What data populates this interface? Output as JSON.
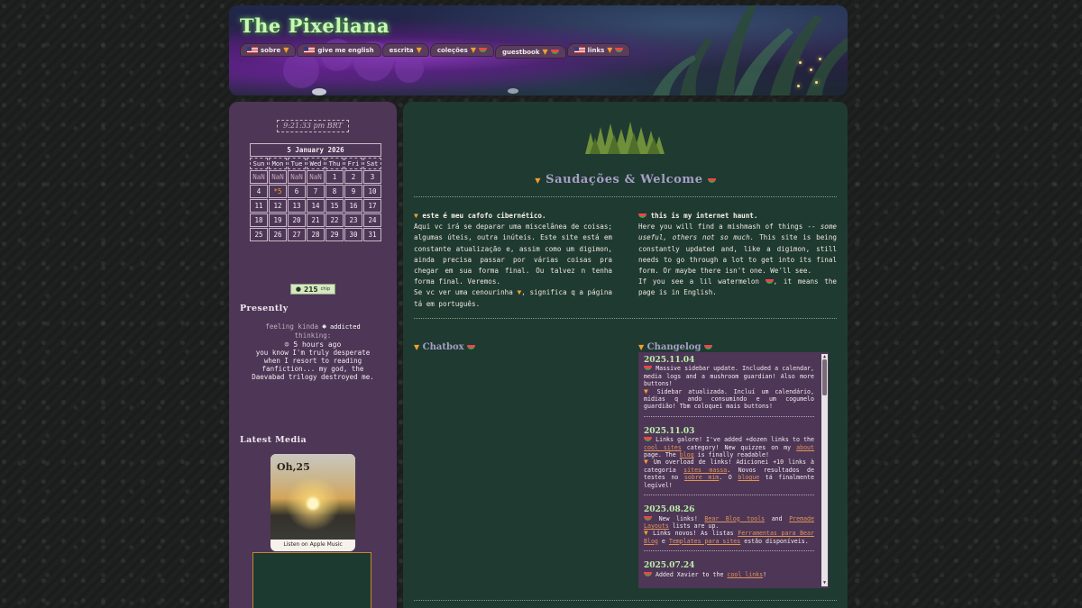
{
  "header": {
    "site_title": "The Pixeliana",
    "nav": [
      {
        "label": "sobre",
        "flag": true,
        "suffix": "carrot"
      },
      {
        "label": "give me english",
        "flag": true,
        "suffix": ""
      },
      {
        "label": "escrita",
        "flag": false,
        "suffix": "carrot"
      },
      {
        "label": "coleções",
        "flag": false,
        "suffix": "both"
      },
      {
        "label": "guestbook",
        "flag": false,
        "suffix": "both"
      },
      {
        "label": "links",
        "flag": true,
        "suffix": "both"
      }
    ]
  },
  "sidebar": {
    "clock": "9:21:33 pm BRT",
    "calendar": {
      "caption": "5 January 2026",
      "days": [
        "Sun",
        "Mon",
        "Tue",
        "Wed",
        "Thu",
        "Fri",
        "Sat"
      ],
      "weeks": [
        [
          "NaN",
          "NaN",
          "NaN",
          "NaN",
          "1",
          "2",
          "3"
        ],
        [
          "4",
          "*5",
          "6",
          "7",
          "8",
          "9",
          "10"
        ],
        [
          "11",
          "12",
          "13",
          "14",
          "15",
          "16",
          "17"
        ],
        [
          "18",
          "19",
          "20",
          "21",
          "22",
          "23",
          "24"
        ],
        [
          "25",
          "26",
          "27",
          "28",
          "29",
          "30",
          "31"
        ]
      ]
    },
    "hit_counter": {
      "value": "215",
      "unit": "chip"
    },
    "presently_heading": "Presently",
    "presently": {
      "feeling_prefix": "feeling kinda",
      "mood": "addicted",
      "feeling_suffix": "thinking:",
      "time_ago": "5 hours ago",
      "status": "you know I'm truly desperate when I resort to reading fanfiction... my god, the Daevabad trilogy destroyed me."
    },
    "latest_media_heading": "Latest Media",
    "media": {
      "title": "Oh,25",
      "link": "Listen on Apple Music"
    }
  },
  "main": {
    "heading": "Saudações & Welcome",
    "pt": {
      "lead": "este é meu cafofo cibernético.",
      "p1": "Aqui vc irá se deparar uma miscelânea de coisas; algumas úteis, outra inúteis. Este site está em constante atualização e, assim como um digimon, ainda precisa passar por várias coisas pra chegar em sua forma final. Ou talvez n tenha forma final. Veremos.",
      "p2_a": "Se vc ver uma cenourinha",
      "p2_b": ", significa q a página tá em português."
    },
    "en": {
      "lead": "this is my internet haunt.",
      "p1_a": "Here you will find a mishmash of things --",
      "p1_em": "some useful, others not so much.",
      "p1_b": "This site is being constantly updated and, like a digimon, still needs to go through a lot to get into its final form. Or maybe there isn't one. We'll see.",
      "p2_a": "If you see a lil watermelon",
      "p2_b": ", it means the page is in English."
    },
    "chatbox_title": "Chatbox",
    "changelog_title": "Changelog",
    "changelog": [
      {
        "date": "2025.11.04",
        "en": "Massive sidebar update. Included a calendar, media logs and a mushroom guardian! Also more buttons!",
        "pt": "Sidebar atualizada. Incluí um calendário, mídias q ando consumindo e um cogumelo guardião! Tbm coloquei mais buttons!"
      },
      {
        "date": "2025.11.03",
        "en_a": "Links galore! I've added +dozen links to the",
        "en_l1": "cool sites",
        "en_b": "category! New quizzes on my",
        "en_l2": "about",
        "en_c": "page. The",
        "en_l3": "blog",
        "en_d": "is finally readable!",
        "pt_a": "Um overload de links! Adicionei +10 links à categoria",
        "pt_l1": "sites massa",
        "pt_b": ". Novos resultados de testes no",
        "pt_l2": "sobre mim",
        "pt_c": ". O",
        "pt_l3": "blogue",
        "pt_d": "tá finalmente legível!"
      },
      {
        "date": "2025.08.26",
        "en_a": "New links!",
        "en_l1": "Bear Blog tools",
        "en_b": "and",
        "en_l2": "Premade Layouts",
        "en_c": "lists are up.",
        "pt_a": "Links novos! As listas",
        "pt_l1": "Ferramentas para Bear Blog",
        "pt_b": "e",
        "pt_l2": "Templates para sites",
        "pt_c": "estão disponíveis."
      },
      {
        "date": "2025.07.24",
        "en_a": "Added Xavier to the",
        "en_l1": "cool links",
        "en_b": "!"
      }
    ]
  }
}
